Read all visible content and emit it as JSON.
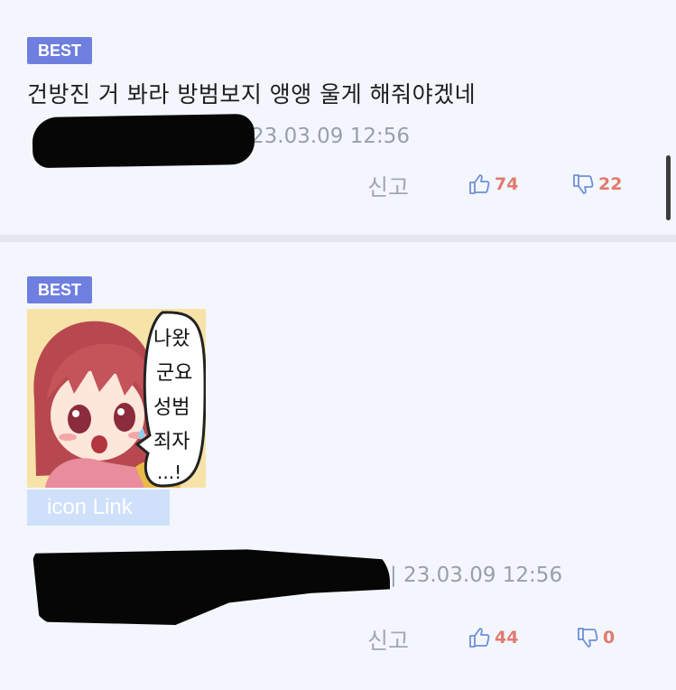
{
  "comments": [
    {
      "badge": "BEST",
      "text": "건방진 거 봐라 방범보지 앵앵 울게 해줘야겠네",
      "timestamp": "23.03.09 12:56",
      "report_label": "신고",
      "upvotes": "74",
      "downvotes": "22"
    },
    {
      "badge": "BEST",
      "sticker_text": [
        "나왔",
        "군요",
        "성범",
        "죄자",
        "...!"
      ],
      "icon_link_label": "icon Link",
      "timestamp": "| 23.03.09 12:56",
      "report_label": "신고",
      "upvotes": "44",
      "downvotes": "0"
    }
  ],
  "colors": {
    "background": "#f3f6fc",
    "badge": "#6e7fe0",
    "vote_icon": "#6f8fd8",
    "vote_count": "#e07b6e",
    "redaction": "#060606"
  },
  "icons": {
    "thumbs_up": "thumbs-up-icon",
    "thumbs_down": "thumbs-down-icon"
  }
}
